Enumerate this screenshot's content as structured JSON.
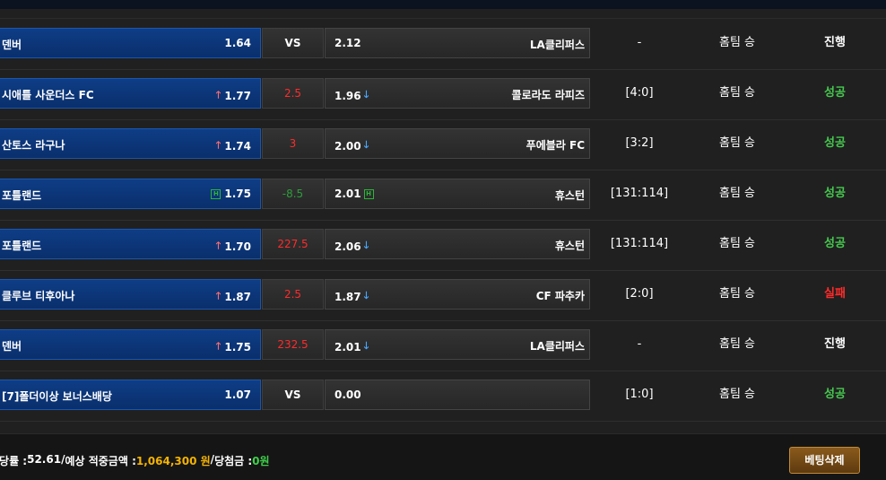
{
  "rows": [
    {
      "home": "덴버",
      "home_odds": "1.64",
      "home_mark": "",
      "mid": "VS",
      "mid_style": "vs",
      "away_odds": "2.12",
      "away_mark": "",
      "away": "LA클리퍼스",
      "score": "-",
      "pick": "홈팀 승",
      "result": "진행",
      "result_style": "ongoing"
    },
    {
      "home": "시애틀 사운더스 FC",
      "home_odds": "1.77",
      "home_mark": "up",
      "mid": "2.5",
      "mid_style": "red",
      "away_odds": "1.96",
      "away_mark": "down",
      "away": "콜로라도 라피즈",
      "score": "[4:0]",
      "pick": "홈팀 승",
      "result": "성공",
      "result_style": "success"
    },
    {
      "home": "산토스 라구나",
      "home_odds": "1.74",
      "home_mark": "up",
      "mid": "3",
      "mid_style": "red",
      "away_odds": "2.00",
      "away_mark": "down",
      "away": "푸에블라 FC",
      "score": "[3:2]",
      "pick": "홈팀 승",
      "result": "성공",
      "result_style": "success"
    },
    {
      "home": "포틀랜드",
      "home_odds": "1.75",
      "home_mark": "h",
      "mid": "-8.5",
      "mid_style": "green",
      "away_odds": "2.01",
      "away_mark": "h",
      "away": "휴스턴",
      "score": "[131:114]",
      "pick": "홈팀 승",
      "result": "성공",
      "result_style": "success"
    },
    {
      "home": "포틀랜드",
      "home_odds": "1.70",
      "home_mark": "up",
      "mid": "227.5",
      "mid_style": "red",
      "away_odds": "2.06",
      "away_mark": "down",
      "away": "휴스턴",
      "score": "[131:114]",
      "pick": "홈팀 승",
      "result": "성공",
      "result_style": "success"
    },
    {
      "home": "클루브 티후아나",
      "home_odds": "1.87",
      "home_mark": "up",
      "mid": "2.5",
      "mid_style": "red",
      "away_odds": "1.87",
      "away_mark": "down",
      "away": "CF 파추카",
      "score": "[2:0]",
      "pick": "홈팀 승",
      "result": "실패",
      "result_style": "fail"
    },
    {
      "home": "덴버",
      "home_odds": "1.75",
      "home_mark": "up",
      "mid": "232.5",
      "mid_style": "red",
      "away_odds": "2.01",
      "away_mark": "down",
      "away": "LA클리퍼스",
      "score": "-",
      "pick": "홈팀 승",
      "result": "진행",
      "result_style": "ongoing"
    },
    {
      "home": "[7]폴더이상 보너스배당",
      "home_odds": "1.07",
      "home_mark": "",
      "mid": "VS",
      "mid_style": "vs",
      "away_odds": "0.00",
      "away_mark": "",
      "away": "",
      "score": "[1:0]",
      "pick": "홈팀 승",
      "result": "성공",
      "result_style": "success"
    }
  ],
  "marks": {
    "up": "🡑",
    "down": "🡓",
    "h": "H"
  },
  "footer": {
    "odds_label": "배당률 : ",
    "odds_value": "52.61",
    "sep1": " / ",
    "expected_label": "예상 적중금액 : ",
    "expected_value": "1,064,300 원",
    "sep2": " / ",
    "win_label": "당첨금 : ",
    "win_value": "0원",
    "delete_button": "베팅삭제"
  },
  "colors": {
    "home_bg": "#0e3d86",
    "success": "#47c84f",
    "fail": "#ff2b2b",
    "gold": "#f5b400"
  }
}
